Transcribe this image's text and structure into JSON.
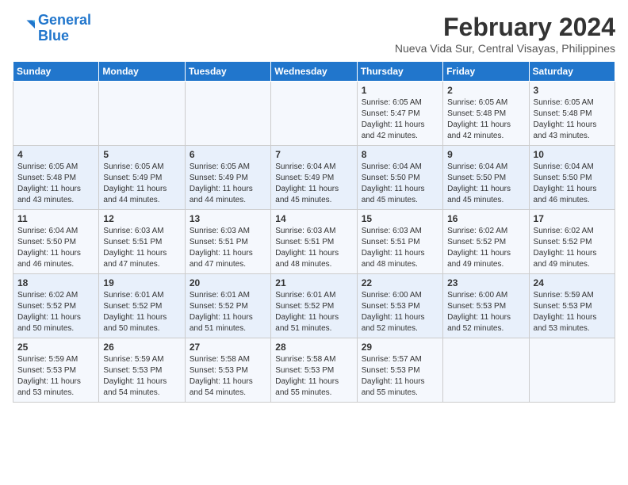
{
  "logo": {
    "line1": "General",
    "line2": "Blue"
  },
  "title": "February 2024",
  "location": "Nueva Vida Sur, Central Visayas, Philippines",
  "days_header": [
    "Sunday",
    "Monday",
    "Tuesday",
    "Wednesday",
    "Thursday",
    "Friday",
    "Saturday"
  ],
  "weeks": [
    [
      {
        "day": "",
        "info": ""
      },
      {
        "day": "",
        "info": ""
      },
      {
        "day": "",
        "info": ""
      },
      {
        "day": "",
        "info": ""
      },
      {
        "day": "1",
        "info": "Sunrise: 6:05 AM\nSunset: 5:47 PM\nDaylight: 11 hours\nand 42 minutes."
      },
      {
        "day": "2",
        "info": "Sunrise: 6:05 AM\nSunset: 5:48 PM\nDaylight: 11 hours\nand 42 minutes."
      },
      {
        "day": "3",
        "info": "Sunrise: 6:05 AM\nSunset: 5:48 PM\nDaylight: 11 hours\nand 43 minutes."
      }
    ],
    [
      {
        "day": "4",
        "info": "Sunrise: 6:05 AM\nSunset: 5:48 PM\nDaylight: 11 hours\nand 43 minutes."
      },
      {
        "day": "5",
        "info": "Sunrise: 6:05 AM\nSunset: 5:49 PM\nDaylight: 11 hours\nand 44 minutes."
      },
      {
        "day": "6",
        "info": "Sunrise: 6:05 AM\nSunset: 5:49 PM\nDaylight: 11 hours\nand 44 minutes."
      },
      {
        "day": "7",
        "info": "Sunrise: 6:04 AM\nSunset: 5:49 PM\nDaylight: 11 hours\nand 45 minutes."
      },
      {
        "day": "8",
        "info": "Sunrise: 6:04 AM\nSunset: 5:50 PM\nDaylight: 11 hours\nand 45 minutes."
      },
      {
        "day": "9",
        "info": "Sunrise: 6:04 AM\nSunset: 5:50 PM\nDaylight: 11 hours\nand 45 minutes."
      },
      {
        "day": "10",
        "info": "Sunrise: 6:04 AM\nSunset: 5:50 PM\nDaylight: 11 hours\nand 46 minutes."
      }
    ],
    [
      {
        "day": "11",
        "info": "Sunrise: 6:04 AM\nSunset: 5:50 PM\nDaylight: 11 hours\nand 46 minutes."
      },
      {
        "day": "12",
        "info": "Sunrise: 6:03 AM\nSunset: 5:51 PM\nDaylight: 11 hours\nand 47 minutes."
      },
      {
        "day": "13",
        "info": "Sunrise: 6:03 AM\nSunset: 5:51 PM\nDaylight: 11 hours\nand 47 minutes."
      },
      {
        "day": "14",
        "info": "Sunrise: 6:03 AM\nSunset: 5:51 PM\nDaylight: 11 hours\nand 48 minutes."
      },
      {
        "day": "15",
        "info": "Sunrise: 6:03 AM\nSunset: 5:51 PM\nDaylight: 11 hours\nand 48 minutes."
      },
      {
        "day": "16",
        "info": "Sunrise: 6:02 AM\nSunset: 5:52 PM\nDaylight: 11 hours\nand 49 minutes."
      },
      {
        "day": "17",
        "info": "Sunrise: 6:02 AM\nSunset: 5:52 PM\nDaylight: 11 hours\nand 49 minutes."
      }
    ],
    [
      {
        "day": "18",
        "info": "Sunrise: 6:02 AM\nSunset: 5:52 PM\nDaylight: 11 hours\nand 50 minutes."
      },
      {
        "day": "19",
        "info": "Sunrise: 6:01 AM\nSunset: 5:52 PM\nDaylight: 11 hours\nand 50 minutes."
      },
      {
        "day": "20",
        "info": "Sunrise: 6:01 AM\nSunset: 5:52 PM\nDaylight: 11 hours\nand 51 minutes."
      },
      {
        "day": "21",
        "info": "Sunrise: 6:01 AM\nSunset: 5:52 PM\nDaylight: 11 hours\nand 51 minutes."
      },
      {
        "day": "22",
        "info": "Sunrise: 6:00 AM\nSunset: 5:53 PM\nDaylight: 11 hours\nand 52 minutes."
      },
      {
        "day": "23",
        "info": "Sunrise: 6:00 AM\nSunset: 5:53 PM\nDaylight: 11 hours\nand 52 minutes."
      },
      {
        "day": "24",
        "info": "Sunrise: 5:59 AM\nSunset: 5:53 PM\nDaylight: 11 hours\nand 53 minutes."
      }
    ],
    [
      {
        "day": "25",
        "info": "Sunrise: 5:59 AM\nSunset: 5:53 PM\nDaylight: 11 hours\nand 53 minutes."
      },
      {
        "day": "26",
        "info": "Sunrise: 5:59 AM\nSunset: 5:53 PM\nDaylight: 11 hours\nand 54 minutes."
      },
      {
        "day": "27",
        "info": "Sunrise: 5:58 AM\nSunset: 5:53 PM\nDaylight: 11 hours\nand 54 minutes."
      },
      {
        "day": "28",
        "info": "Sunrise: 5:58 AM\nSunset: 5:53 PM\nDaylight: 11 hours\nand 55 minutes."
      },
      {
        "day": "29",
        "info": "Sunrise: 5:57 AM\nSunset: 5:53 PM\nDaylight: 11 hours\nand 55 minutes."
      },
      {
        "day": "",
        "info": ""
      },
      {
        "day": "",
        "info": ""
      }
    ]
  ]
}
